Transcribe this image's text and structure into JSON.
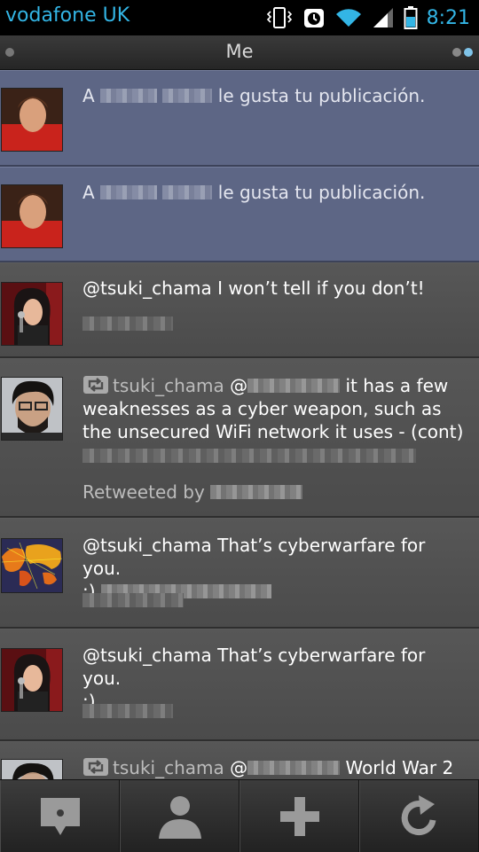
{
  "status_bar": {
    "carrier": "vodafone UK",
    "time": "8:21",
    "accent_color": "#33b5e5"
  },
  "title_bar": {
    "title": "Me"
  },
  "feed": {
    "items": [
      {
        "type": "notification",
        "prefix": "A",
        "suffix": "le gusta tu publicación."
      },
      {
        "type": "notification",
        "prefix": "A",
        "suffix": "le gusta tu publicación."
      },
      {
        "type": "tweet",
        "text": "@tsuki_chama I won’t tell if you don’t!"
      },
      {
        "type": "retweet",
        "user": "tsuki_chama",
        "at": "@",
        "text_rest": "it has a few",
        "line2": "weaknesses as a cyber weapon, such as",
        "line3": "the unsecured WiFi network it uses - (cont)",
        "retweeted_by": "Retweeted by"
      },
      {
        "type": "tweet",
        "text": "@tsuki_chama That’s cyberwarfare for you.",
        "line2": ";)"
      },
      {
        "type": "tweet",
        "text": "@tsuki_chama That’s cyberwarfare for you.",
        "line2": ";)"
      },
      {
        "type": "retweet",
        "user": "tsuki_chama",
        "at": "@",
        "text_rest": "World War 2"
      }
    ]
  },
  "bottom_bar": {
    "tabs": [
      {
        "icon": "speech-bubble-icon"
      },
      {
        "icon": "person-icon"
      },
      {
        "icon": "plus-icon"
      },
      {
        "icon": "refresh-icon"
      }
    ]
  },
  "notification_bg_color": "#5d6685"
}
